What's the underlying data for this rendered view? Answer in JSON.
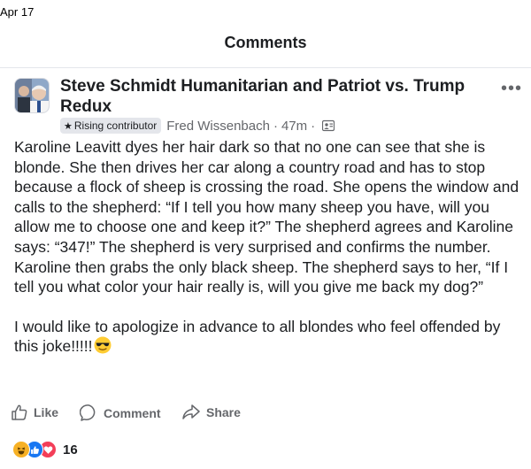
{
  "status_bar": {
    "date": "Apr 17"
  },
  "header": {
    "title": "Comments"
  },
  "post": {
    "group_name": "Steve Schmidt Humanitarian and Patriot vs. Trump Redux",
    "badge": "Rising contributor",
    "author": "Fred Wissenbach",
    "separator": "·",
    "time": "47m",
    "privacy_icon": "group-members-icon",
    "body_paragraph_1": "Karoline Leavitt dyes her hair dark so that no one can see that she is blonde. She then drives her car along a country road and has to stop because a flock of sheep is crossing the road. She opens the window and calls to the shepherd: “If I tell you how many sheep you have, will you allow me to choose one and keep it?” The shepherd agrees and Karoline says: “347!” The shepherd is very surprised and confirms the number. Karoline then grabs the only black sheep. The shepherd says to her, “If I tell you what color your hair really is, will you give me back my dog?”",
    "body_paragraph_2": "I would like to apologize in advance to all blondes who feel offended by this joke!!!!!",
    "body_emoji": "sunglasses-face-icon"
  },
  "actions": {
    "like_label": "Like",
    "comment_label": "Comment",
    "share_label": "Share"
  },
  "reactions": {
    "icons": [
      "haha-icon",
      "like-icon",
      "love-icon"
    ],
    "count": "16"
  },
  "colors": {
    "secondary_text": "#65676b",
    "primary_text": "#1c1e21",
    "like_blue": "#1877f2",
    "love_red": "#f33e58",
    "haha_yellow": "#f7b125",
    "badge_bg": "#e4e6eb"
  }
}
